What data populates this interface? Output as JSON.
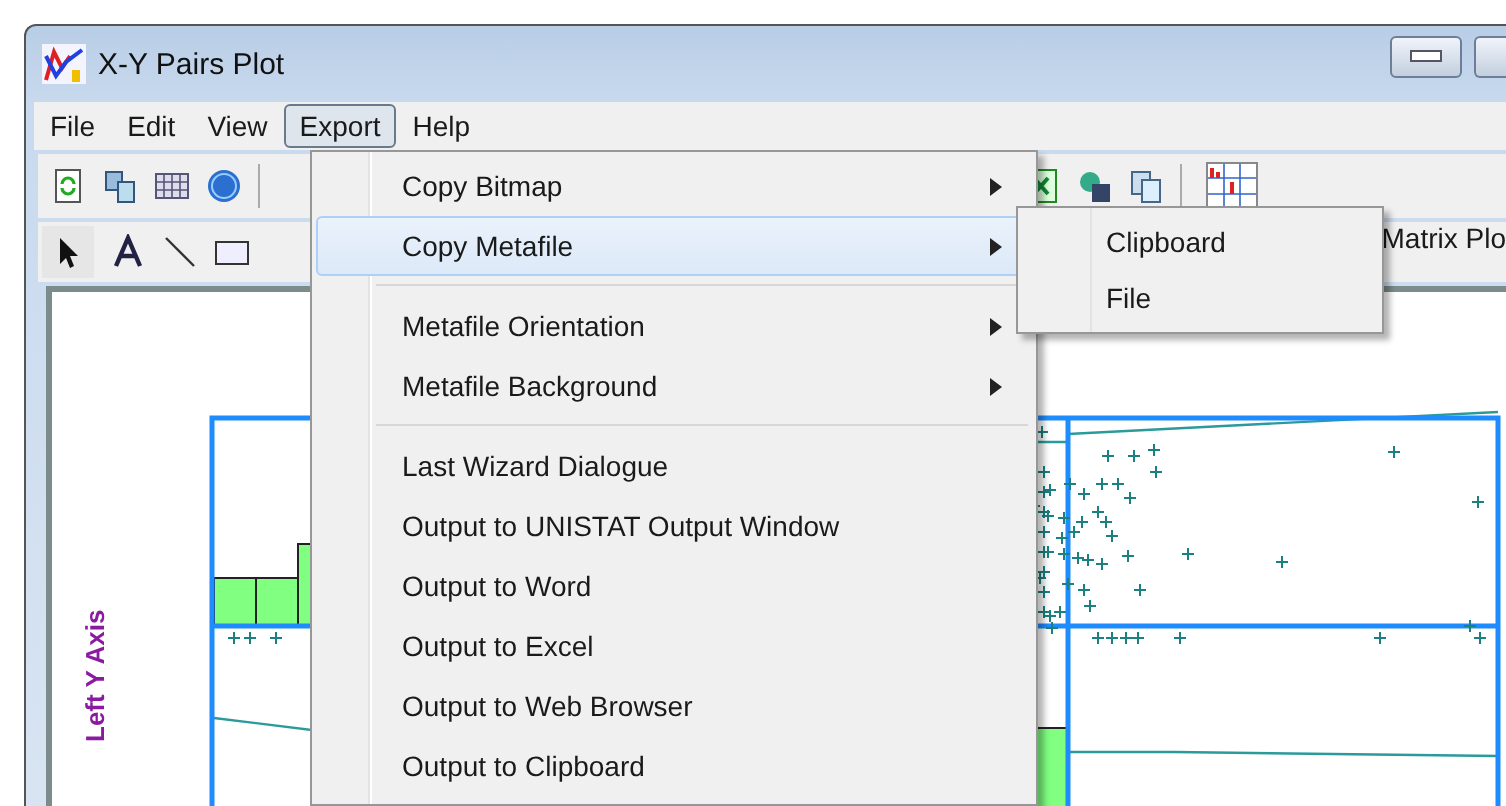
{
  "window": {
    "title": "X-Y Pairs Plot"
  },
  "menubar": [
    {
      "label": "File",
      "selected": false
    },
    {
      "label": "Edit",
      "selected": false
    },
    {
      "label": "View",
      "selected": false
    },
    {
      "label": "Export",
      "selected": true
    },
    {
      "label": "Help",
      "selected": false
    }
  ],
  "toolbar": {
    "matrix_label": "Matrix Plo"
  },
  "export_menu": {
    "groups": [
      [
        {
          "label": "Copy Bitmap",
          "submenu": true,
          "selected": false
        },
        {
          "label": "Copy Metafile",
          "submenu": true,
          "selected": true
        }
      ],
      [
        {
          "label": "Metafile Orientation",
          "submenu": true,
          "selected": false
        },
        {
          "label": "Metafile Background",
          "submenu": true,
          "selected": false
        }
      ],
      [
        {
          "label": "Last Wizard Dialogue",
          "submenu": false,
          "selected": false
        },
        {
          "label": "Output to UNISTAT Output Window",
          "submenu": false,
          "selected": false
        },
        {
          "label": "Output to Word",
          "submenu": false,
          "selected": false
        },
        {
          "label": "Output to Excel",
          "submenu": false,
          "selected": false
        },
        {
          "label": "Output to Web Browser",
          "submenu": false,
          "selected": false
        },
        {
          "label": "Output to Clipboard",
          "submenu": false,
          "selected": false
        }
      ]
    ]
  },
  "submenu": {
    "items": [
      {
        "label": "Clipboard",
        "selected": false
      },
      {
        "label": "File",
        "selected": false
      }
    ]
  },
  "plot": {
    "y_axis_label": "Left Y Axis"
  }
}
